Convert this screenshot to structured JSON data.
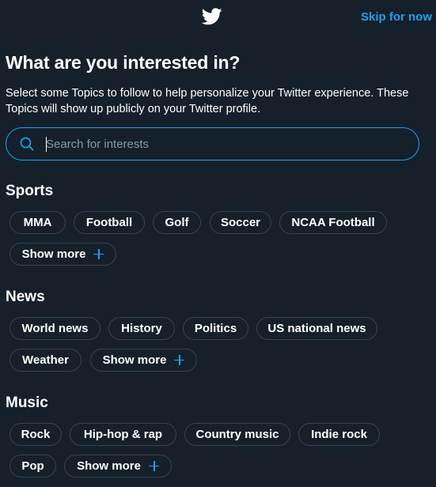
{
  "header": {
    "logo_icon": "twitter-bird-icon",
    "skip_label": "Skip for now"
  },
  "intro": {
    "title": "What are you interested in?",
    "subtitle": "Select some Topics to follow to help personalize your Twitter experience. These Topics will show up publicly on your Twitter profile."
  },
  "search": {
    "icon": "search-icon",
    "placeholder": "Search for interests",
    "value": ""
  },
  "sections": [
    {
      "title": "Sports",
      "topics": [
        "MMA",
        "Football",
        "Golf",
        "Soccer",
        "NCAA Football"
      ],
      "show_more": "Show more"
    },
    {
      "title": "News",
      "topics": [
        "World news",
        "History",
        "Politics",
        "US national news",
        "Weather"
      ],
      "show_more": "Show more"
    },
    {
      "title": "Music",
      "topics": [
        "Rock",
        "Hip-hop & rap",
        "Country music",
        "Indie rock",
        "Pop"
      ],
      "show_more": "Show more"
    }
  ],
  "colors": {
    "background": "#15202b",
    "accent": "#1da1f2",
    "chip_border": "#38444d",
    "text": "#ffffff",
    "placeholder": "#8899a6"
  }
}
